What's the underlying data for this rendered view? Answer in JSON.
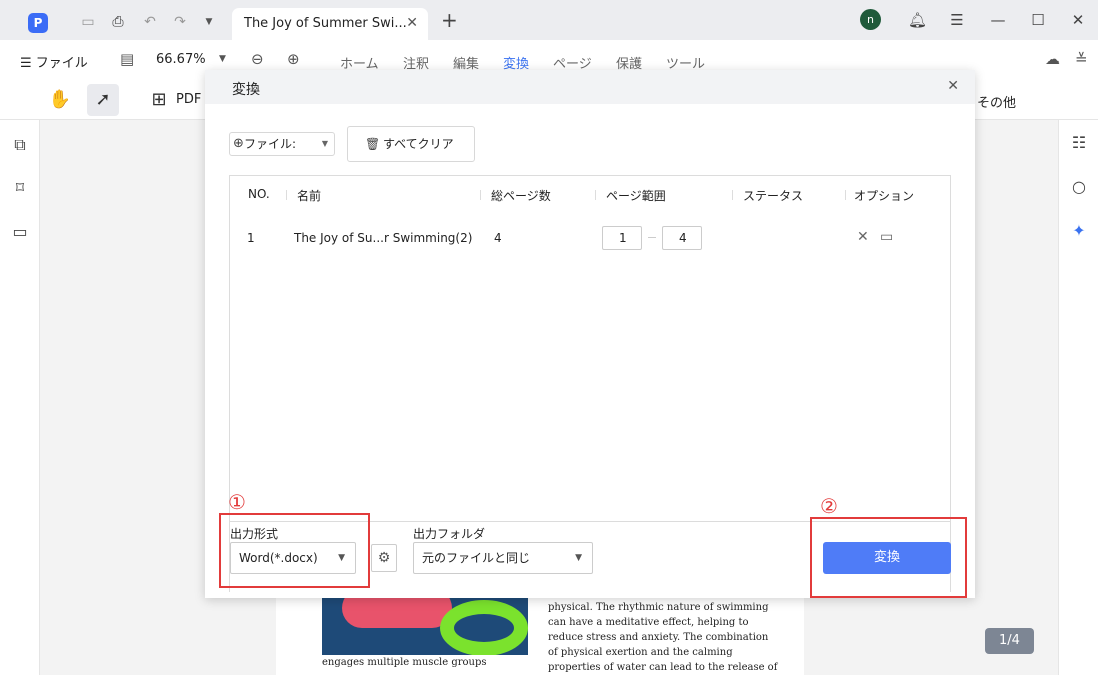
{
  "titlebar": {
    "logo": "P",
    "tab_title": "The Joy of Summer Swi...",
    "avatar_initial": "n"
  },
  "menubar": {
    "file_label": "ファイル",
    "zoom": "66.67%",
    "tabs": [
      {
        "label": "ホーム",
        "active": false
      },
      {
        "label": "注釈",
        "active": false
      },
      {
        "label": "編集",
        "active": false
      },
      {
        "label": "変換",
        "active": true
      },
      {
        "label": "ページ",
        "active": false
      },
      {
        "label": "保護",
        "active": false
      },
      {
        "label": "ツール",
        "active": false
      }
    ]
  },
  "toolbar": {
    "pdf_label": "PDF",
    "other_label": "その他"
  },
  "document": {
    "caption": "engages multiple muscle groups",
    "text_lines": [
      "physical. The rhythmic nature of swimming",
      "can have a meditative effect, helping to",
      "reduce stress and anxiety. The combination",
      "of physical exertion and the calming",
      "properties of water can lead to the release of"
    ],
    "page_counter": "1/4"
  },
  "dialog": {
    "title": "変換",
    "add_file_label": "ファイル:",
    "clear_all_label": "すべてクリア",
    "columns": {
      "no": "NO.",
      "name": "名前",
      "total_pages": "総ページ数",
      "page_range": "ページ範囲",
      "status": "ステータス",
      "options": "オプション"
    },
    "rows": [
      {
        "no": "1",
        "name": "The Joy of Su...r Swimming(2)",
        "total_pages": "4",
        "range_from": "1",
        "range_to": "4",
        "status": ""
      }
    ],
    "output_format_label": "出力形式",
    "output_format_value": "Word(*.docx)",
    "output_folder_label": "出力フォルダ",
    "output_folder_value": "元のファイルと同じ",
    "convert_label": "変換"
  },
  "annotations": {
    "marker_1": "①",
    "marker_2": "②",
    "color": "#e23b3b"
  },
  "colors": {
    "accent": "#4f7cf7",
    "active_tab": "#3a72f0"
  }
}
